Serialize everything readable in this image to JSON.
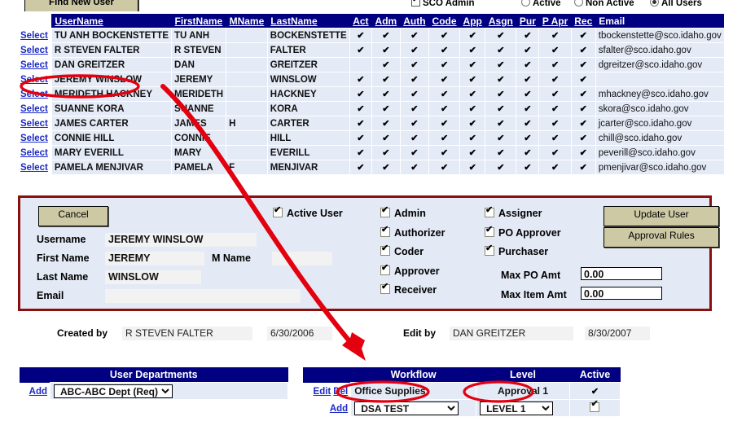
{
  "topbar": {
    "find_new_user_label": "Find New User",
    "sco_admin_label": "SCO Admin",
    "sco_admin_checked": true,
    "filter_options": [
      {
        "label": "Active",
        "selected": false
      },
      {
        "label": "Non Active",
        "selected": false
      },
      {
        "label": "All Users",
        "selected": true
      }
    ]
  },
  "user_table": {
    "columns": [
      "UserName",
      "FirstName",
      "MName",
      "LastName",
      "Act",
      "Adm",
      "Auth",
      "Code",
      "App",
      "Asgn",
      "Pur",
      "P Apr",
      "Rec",
      "Email"
    ],
    "select_label": "Select",
    "rows": [
      {
        "username": "TU ANH BOCKENSTETTE",
        "first": "TU ANH",
        "mname": "",
        "last": "BOCKENSTETTE",
        "act": true,
        "adm": true,
        "auth": true,
        "code": true,
        "app": true,
        "asgn": true,
        "pur": true,
        "papr": true,
        "rec": true,
        "email": "tbockenstette@sco.idaho.gov"
      },
      {
        "username": "R STEVEN FALTER",
        "first": "R STEVEN",
        "mname": "",
        "last": "FALTER",
        "act": true,
        "adm": true,
        "auth": true,
        "code": true,
        "app": true,
        "asgn": true,
        "pur": true,
        "papr": true,
        "rec": true,
        "email": "sfalter@sco.idaho.gov"
      },
      {
        "username": "DAN GREITZER",
        "first": "DAN",
        "mname": "",
        "last": "GREITZER",
        "act": false,
        "adm": true,
        "auth": true,
        "code": true,
        "app": true,
        "asgn": true,
        "pur": true,
        "papr": true,
        "rec": true,
        "email": "dgreitzer@sco.idaho.gov"
      },
      {
        "username": "JEREMY WINSLOW",
        "first": "JEREMY",
        "mname": "",
        "last": "WINSLOW",
        "act": true,
        "adm": true,
        "auth": true,
        "code": true,
        "app": true,
        "asgn": true,
        "pur": true,
        "papr": true,
        "rec": true,
        "email": ""
      },
      {
        "username": "MERIDETH HACKNEY",
        "first": "MERIDETH",
        "mname": "",
        "last": "HACKNEY",
        "act": true,
        "adm": true,
        "auth": true,
        "code": true,
        "app": true,
        "asgn": true,
        "pur": true,
        "papr": true,
        "rec": true,
        "email": "mhackney@sco.idaho.gov"
      },
      {
        "username": "SUANNE KORA",
        "first": "SUANNE",
        "mname": "",
        "last": "KORA",
        "act": true,
        "adm": true,
        "auth": true,
        "code": true,
        "app": true,
        "asgn": true,
        "pur": true,
        "papr": true,
        "rec": true,
        "email": "skora@sco.idaho.gov"
      },
      {
        "username": "JAMES CARTER",
        "first": "JAMES",
        "mname": "H",
        "last": "CARTER",
        "act": true,
        "adm": true,
        "auth": true,
        "code": true,
        "app": true,
        "asgn": true,
        "pur": true,
        "papr": true,
        "rec": true,
        "email": "jcarter@sco.idaho.gov"
      },
      {
        "username": "CONNIE HILL",
        "first": "CONNIE",
        "mname": "",
        "last": "HILL",
        "act": true,
        "adm": true,
        "auth": true,
        "code": true,
        "app": true,
        "asgn": true,
        "pur": true,
        "papr": true,
        "rec": true,
        "email": "chill@sco.idaho.gov"
      },
      {
        "username": "MARY EVERILL",
        "first": "MARY",
        "mname": "",
        "last": "EVERILL",
        "act": true,
        "adm": true,
        "auth": true,
        "code": true,
        "app": true,
        "asgn": true,
        "pur": true,
        "papr": true,
        "rec": true,
        "email": "peverill@sco.idaho.gov"
      },
      {
        "username": "PAMELA MENJIVAR",
        "first": "PAMELA",
        "mname": "F",
        "last": "MENJIVAR",
        "act": true,
        "adm": true,
        "auth": true,
        "code": true,
        "app": true,
        "asgn": true,
        "pur": true,
        "papr": true,
        "rec": true,
        "email": "pmenjivar@sco.idaho.gov"
      }
    ]
  },
  "detail": {
    "cancel_label": "Cancel",
    "update_user_label": "Update User",
    "approval_rules_label": "Approval Rules",
    "active_user_label": "Active User",
    "active_user_checked": true,
    "username_label": "Username",
    "username_value": "JEREMY WINSLOW",
    "first_name_label": "First Name",
    "first_name_value": "JEREMY",
    "m_name_label": "M Name",
    "m_name_value": "",
    "last_name_label": "Last Name",
    "last_name_value": "WINSLOW",
    "email_label": "Email",
    "email_value": "",
    "roles_col1": [
      {
        "label": "Admin",
        "checked": true
      },
      {
        "label": "Authorizer",
        "checked": true
      },
      {
        "label": "Coder",
        "checked": true
      },
      {
        "label": "Approver",
        "checked": true
      },
      {
        "label": "Receiver",
        "checked": true
      }
    ],
    "roles_col2": [
      {
        "label": "Assigner",
        "checked": true
      },
      {
        "label": "PO Approver",
        "checked": true
      },
      {
        "label": "Purchaser",
        "checked": true
      }
    ],
    "max_po_amt_label": "Max PO Amt",
    "max_po_amt_value": "0.00",
    "max_item_amt_label": "Max Item Amt",
    "max_item_amt_value": "0.00"
  },
  "meta": {
    "created_by_label": "Created by",
    "created_by_value": "R STEVEN FALTER",
    "created_date": "6/30/2006",
    "edit_by_label": "Edit by",
    "edit_by_value": "DAN GREITZER",
    "edit_date": "8/30/2007"
  },
  "departments": {
    "header": "User Departments",
    "add_label": "Add",
    "selected_dept": "ABC-ABC Dept (Req)"
  },
  "workflow": {
    "headers": [
      "Workflow",
      "Level",
      "Active"
    ],
    "edit_label": "Edit",
    "del_label": "Del",
    "add_label": "Add",
    "existing_row": {
      "workflow": "Office Supplies",
      "level": "Approval 1",
      "active": true
    },
    "new_row": {
      "workflow": "DSA TEST",
      "level": "LEVEL 1",
      "active": true
    }
  },
  "annotations": {
    "accent_color": "#e3000f",
    "panel_border_color": "#8b0f0f",
    "header_color": "#000080"
  }
}
